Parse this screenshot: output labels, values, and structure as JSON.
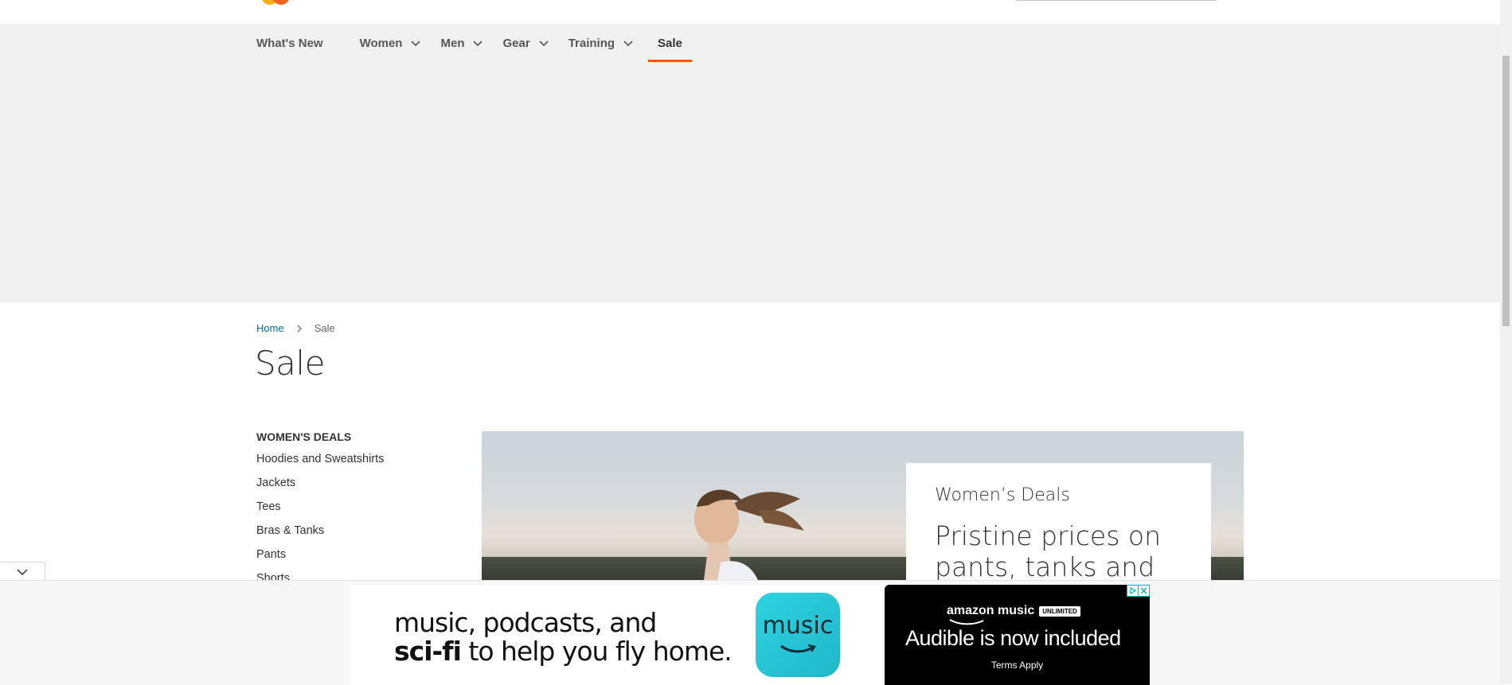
{
  "nav": {
    "items": [
      {
        "label": "What's New",
        "has_dropdown": false
      },
      {
        "label": "Women",
        "has_dropdown": true
      },
      {
        "label": "Men",
        "has_dropdown": true
      },
      {
        "label": "Gear",
        "has_dropdown": true
      },
      {
        "label": "Training",
        "has_dropdown": true
      },
      {
        "label": "Sale",
        "has_dropdown": false,
        "active": true
      }
    ],
    "active_color": "#ff5501"
  },
  "breadcrumb": {
    "home": "Home",
    "current": "Sale"
  },
  "page": {
    "title": "Sale"
  },
  "sidebar": {
    "heading": "WOMEN'S DEALS",
    "links": [
      "Hoodies and Sweatshirts",
      "Jackets",
      "Tees",
      "Bras & Tanks",
      "Pants",
      "Shorts"
    ]
  },
  "hero": {
    "kicker": "Women’s Deals",
    "headline": "Pristine prices on pants, tanks and"
  },
  "ad": {
    "left_line1": "music, podcasts, and",
    "left_line2_bold": "sci-fi",
    "left_line2_rest": " to help you fly home.",
    "app_icon_label": "music",
    "brand": "amazon music",
    "brand_badge": "UNLIMITED",
    "headline": "Audible is now included",
    "terms": "Terms Apply"
  },
  "colors": {
    "link": "#006bb4",
    "band": "#f0f0f0",
    "ad_icon": "#2ed3e0"
  },
  "icons": [
    "chevron-down-icon",
    "chevron-right-icon",
    "ad-info-icon",
    "ad-close-icon",
    "logo-icon"
  ]
}
